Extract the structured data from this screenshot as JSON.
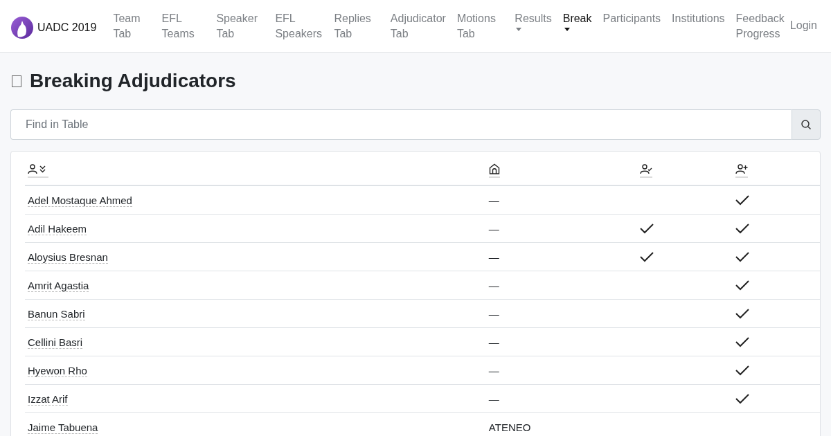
{
  "brand": {
    "name": "UADC 2019"
  },
  "nav": [
    {
      "label": "Team Tab",
      "selected": false,
      "dropdown": false
    },
    {
      "label": "EFL Teams",
      "selected": false,
      "dropdown": false
    },
    {
      "label": "Speaker Tab",
      "selected": false,
      "dropdown": false
    },
    {
      "label": "EFL Speakers",
      "selected": false,
      "dropdown": false
    },
    {
      "label": "Replies Tab",
      "selected": false,
      "dropdown": false
    },
    {
      "label": "Adjudicator Tab",
      "selected": false,
      "dropdown": false
    },
    {
      "label": "Motions Tab",
      "selected": false,
      "dropdown": false
    },
    {
      "label": "Results",
      "selected": false,
      "dropdown": true
    },
    {
      "label": "Break",
      "selected": true,
      "dropdown": true
    },
    {
      "label": "Participants",
      "selected": false,
      "dropdown": false
    },
    {
      "label": "Institutions",
      "selected": false,
      "dropdown": false
    },
    {
      "label": "Feedback Progress",
      "selected": false,
      "dropdown": false
    }
  ],
  "login": "Login",
  "page_title": "Breaking Adjudicators",
  "search": {
    "placeholder": "Find in Table"
  },
  "table": {
    "columns": [
      {
        "kind": "person-sort"
      },
      {
        "kind": "institution"
      },
      {
        "kind": "person-check"
      },
      {
        "kind": "person-add"
      }
    ],
    "rows": [
      {
        "name": "Adel Mostaque Ahmed",
        "institution": "—",
        "col_3": false,
        "col_4": true
      },
      {
        "name": "Adil Hakeem",
        "institution": "—",
        "col_3": true,
        "col_4": true
      },
      {
        "name": "Aloysius Bresnan",
        "institution": "—",
        "col_3": true,
        "col_4": true
      },
      {
        "name": "Amrit Agastia",
        "institution": "—",
        "col_3": false,
        "col_4": true
      },
      {
        "name": "Banun Sabri",
        "institution": "—",
        "col_3": false,
        "col_4": true
      },
      {
        "name": "Cellini Basri",
        "institution": "—",
        "col_3": false,
        "col_4": true
      },
      {
        "name": "Hyewon Rho",
        "institution": "—",
        "col_3": false,
        "col_4": true
      },
      {
        "name": "Izzat Arif",
        "institution": "—",
        "col_3": false,
        "col_4": true
      },
      {
        "name": "Jaime Tabuena",
        "institution": "ATENEO",
        "col_3": false,
        "col_4": false
      }
    ]
  }
}
